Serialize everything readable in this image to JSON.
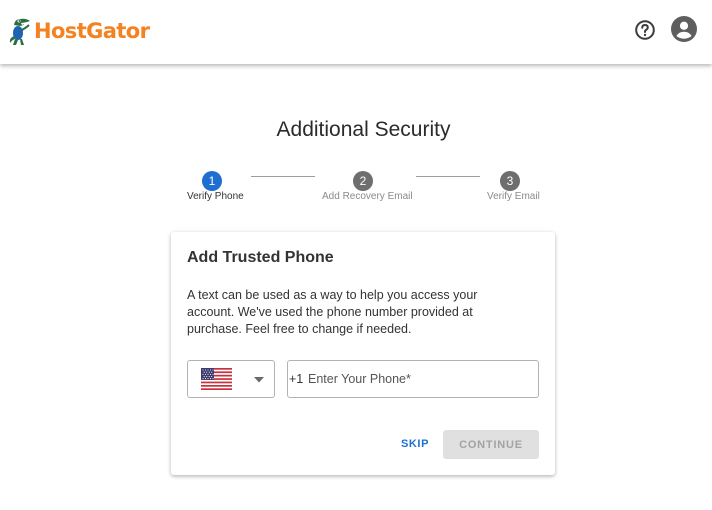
{
  "header": {
    "logo_text": "HostGator",
    "logo_icon": "gator-mascot-icon",
    "help_icon": "help-circle-icon",
    "account_icon": "account-circle-icon"
  },
  "page": {
    "title": "Additional Security"
  },
  "stepper": {
    "steps": [
      {
        "number": "1",
        "label": "Verify Phone",
        "state": "active"
      },
      {
        "number": "2",
        "label": "Add Recovery Email",
        "state": "inactive"
      },
      {
        "number": "3",
        "label": "Verify Email",
        "state": "inactive"
      }
    ]
  },
  "card": {
    "title": "Add Trusted Phone",
    "description": "A text can be used as a way to help you access your account. We've used the phone number provided at purchase. Feel free to change if needed.",
    "country_select": {
      "selected_flag": "us-flag-icon",
      "arrow_icon": "caret-down-icon"
    },
    "phone": {
      "prefix": "+1",
      "value": "",
      "placeholder": "Enter Your Phone*"
    },
    "skip_label": "SKIP",
    "continue_label": "CONTINUE"
  },
  "colors": {
    "brand_orange": "#f58220",
    "accent_blue": "#1f6fd0",
    "inactive_step": "#6e6e6e",
    "disabled_button": "#e0e0e0"
  }
}
